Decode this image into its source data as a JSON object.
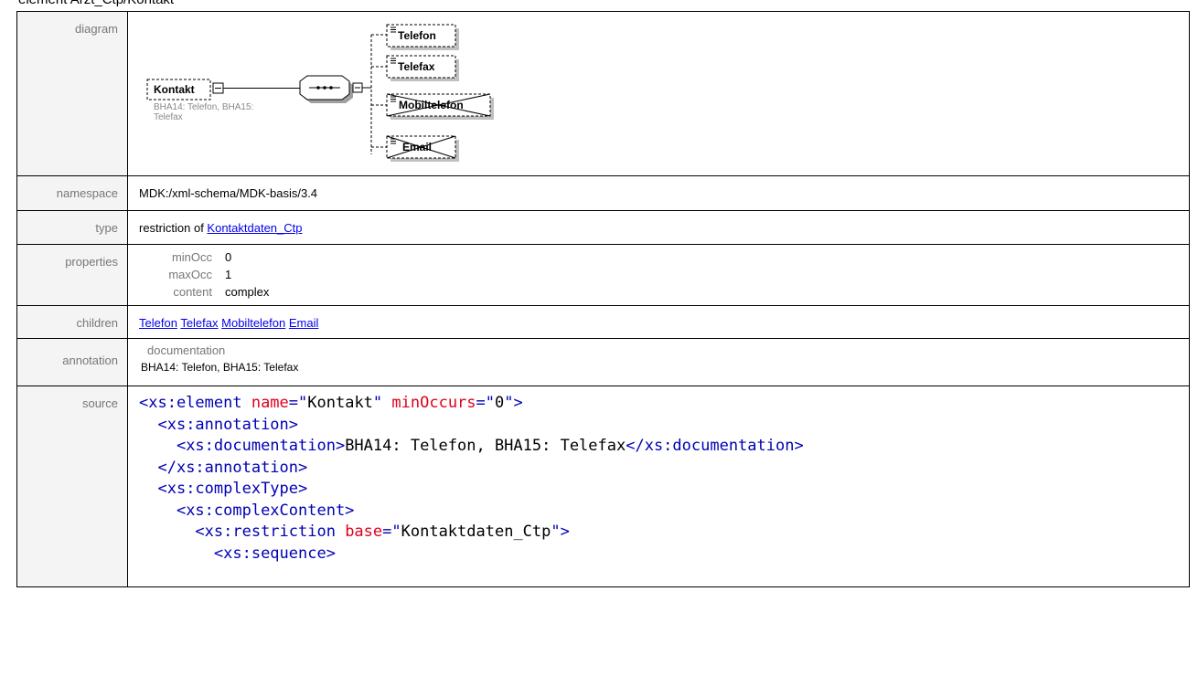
{
  "page": {
    "heading": "element Arzt_Ctp/Kontakt"
  },
  "labels": {
    "diagram": "diagram",
    "namespace": "namespace",
    "type": "type",
    "properties": "properties",
    "children": "children",
    "annotation": "annotation",
    "source": "source"
  },
  "diagram": {
    "element_name": "Kontakt",
    "element_doc_line1": "BHA14: Telefon, BHA15:",
    "element_doc_line2": "Telefax",
    "children": [
      "Telefon",
      "Telefax",
      "Mobiltelefon",
      "Email"
    ]
  },
  "namespace": "MDK:/xml-schema/MDK-basis/3.4",
  "type": {
    "prefix": "restriction of ",
    "link": "Kontaktdaten_Ctp"
  },
  "properties": [
    {
      "key": "minOcc",
      "value": "0"
    },
    {
      "key": "maxOcc",
      "value": "1"
    },
    {
      "key": "content",
      "value": "complex"
    }
  ],
  "children": [
    "Telefon",
    "Telefax",
    "Mobiltelefon",
    "Email"
  ],
  "annotation": {
    "title": "documentation",
    "text": "BHA14: Telefon, BHA15: Telefax"
  },
  "source": {
    "l1_tag": "<xs:element",
    "l1_a1": " name",
    "l1_eq1": "=\"",
    "l1_v1": "Kontakt",
    "l1_q1": "\"",
    "l1_a2": " minOccurs",
    "l1_eq2": "=\"",
    "l1_v2": "0",
    "l1_q2": "\"",
    "l1_end": ">",
    "l2": "<xs:annotation>",
    "l3_open": "<xs:documentation>",
    "l3_text": "BHA14: Telefon, BHA15: Telefax",
    "l3_close": "</xs:documentation>",
    "l4": "</xs:annotation>",
    "l5": "<xs:complexType>",
    "l6": "<xs:complexContent>",
    "l7_tag": "<xs:restriction",
    "l7_a": " base",
    "l7_eq": "=\"",
    "l7_v": "Kontaktdaten_Ctp",
    "l7_q": "\"",
    "l7_end": ">",
    "l8": "<xs:sequence>"
  }
}
